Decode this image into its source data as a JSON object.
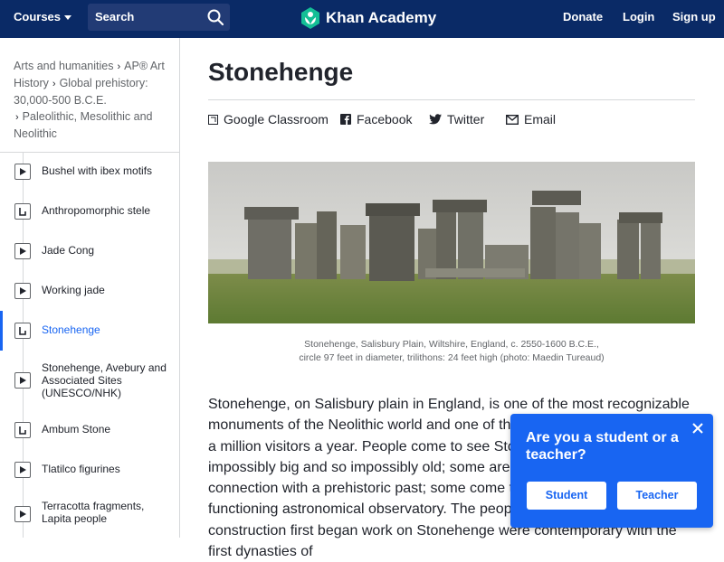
{
  "header": {
    "courses_label": "Courses",
    "search_label": "Search",
    "logo_text": "Khan Academy",
    "donate_label": "Donate",
    "login_label": "Login",
    "signup_label": "Sign up",
    "bg_color": "#0a2a66"
  },
  "breadcrumb": [
    "Arts and humanities",
    "AP® Art History",
    "Global prehistory: 30,000-500 B.C.E.",
    "Paleolithic, Mesolithic and Neolithic"
  ],
  "sidebar": {
    "items": [
      {
        "label": "Bushel with ibex motifs",
        "icon": "play-icon"
      },
      {
        "label": "Anthropomorphic stele",
        "icon": "article-icon"
      },
      {
        "label": "Jade Cong",
        "icon": "play-icon"
      },
      {
        "label": "Working jade",
        "icon": "play-icon"
      },
      {
        "label": "Stonehenge",
        "icon": "article-icon",
        "active": true
      },
      {
        "label": "Stonehenge, Avebury and Associated Sites (UNESCO/NHK)",
        "icon": "play-icon"
      },
      {
        "label": "Ambum Stone",
        "icon": "article-icon"
      },
      {
        "label": "Tlatilco figurines",
        "icon": "play-icon"
      },
      {
        "label": "Terracotta fragments, Lapita people",
        "icon": "play-icon"
      }
    ]
  },
  "article": {
    "title": "Stonehenge",
    "share": {
      "google_classroom": "Google Classroom",
      "facebook": "Facebook",
      "twitter": "Twitter",
      "email": "Email"
    },
    "caption_line1": "Stonehenge, Salisbury Plain, Wiltshire, England, c. 2550-1600 B.C.E.,",
    "caption_line2": "circle 97 feet in diameter, trilithons: 24 feet high (photo: Maedin Tureaud)",
    "body": "Stonehenge, on Salisbury plain in England, is one of the most recognizable monuments of the Neolithic world and one of the most visited, drawing over a million visitors a year. People come to see Stonehenge because it is so impossibly big and so impossibly old; some are seeking a spiritual connection with a prehistoric past; some come to witness the world's largest functioning astronomical observatory. The people living in the area when construction first began work on Stonehenge were contemporary with the first dynasties of"
  },
  "popup": {
    "question": "Are you a student or a teacher?",
    "student_label": "Student",
    "teacher_label": "Teacher",
    "bg_color": "#1865f2"
  }
}
